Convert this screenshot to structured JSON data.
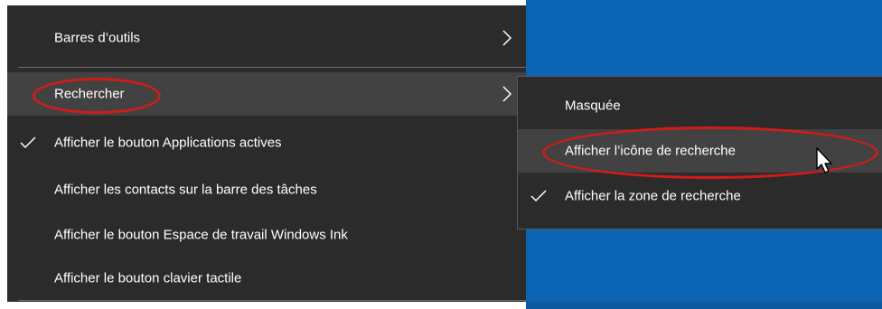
{
  "context_menu": {
    "items": [
      {
        "label": "Barres d’outils",
        "has_submenu": true,
        "checked": false
      },
      {
        "label": "Rechercher",
        "has_submenu": true,
        "checked": false,
        "highlighted": true
      },
      {
        "label": "Afficher le bouton Applications actives",
        "has_submenu": false,
        "checked": true
      },
      {
        "label": "Afficher les contacts sur la barre des tâches",
        "has_submenu": false,
        "checked": false
      },
      {
        "label": "Afficher le bouton Espace de travail Windows Ink",
        "has_submenu": false,
        "checked": false
      },
      {
        "label": "Afficher le bouton clavier tactile",
        "has_submenu": false,
        "checked": false
      }
    ]
  },
  "search_submenu": {
    "items": [
      {
        "label": "Masquée",
        "checked": false
      },
      {
        "label": "Afficher l’icône de recherche",
        "checked": false,
        "highlighted": true
      },
      {
        "label": "Afficher la zone de recherche",
        "checked": true
      }
    ]
  },
  "colors": {
    "menu_background": "#2b2b2b",
    "highlight": "#424242",
    "desktop_blue": "#0c64b4",
    "annotation_red": "#d11b1b",
    "text": "#ffffff"
  },
  "icons": {
    "submenu_arrow": "chevron-right-icon",
    "check": "checkmark-icon",
    "pointer": "mouse-cursor-icon"
  }
}
